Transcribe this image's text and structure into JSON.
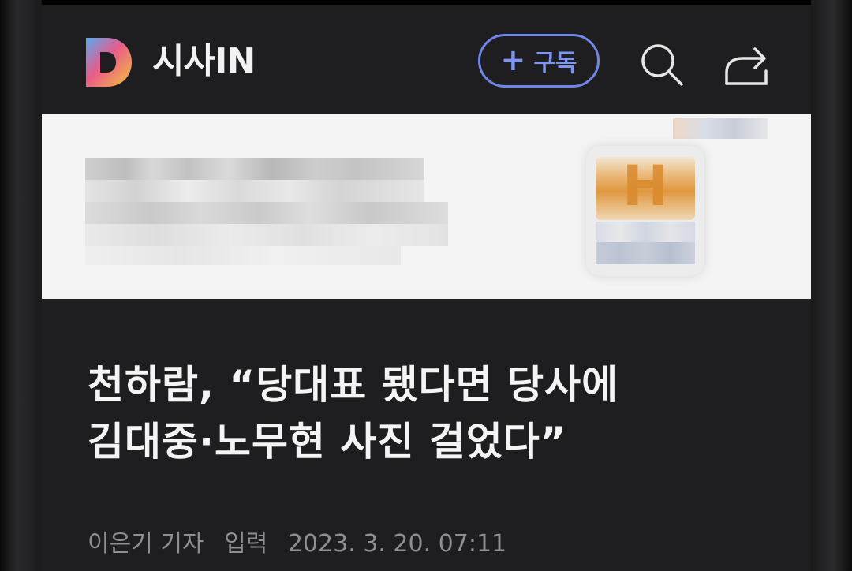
{
  "header": {
    "brand": "시사IN",
    "subscribe_plus": "+",
    "subscribe_label": "구독",
    "logo_icon": "sisain-d-logo",
    "search_icon": "search-icon",
    "share_icon": "share-icon",
    "accent_color": "#6e86e8"
  },
  "banner": {
    "badge_letter": "H"
  },
  "article": {
    "headline_line1": "천하람, “당대표 됐다면 당사에",
    "headline_line2": "김대중·노무현 사진 걸었다”",
    "reporter": "이은기 기자",
    "input_label": "입력",
    "date": "2023. 3. 20. 07:11"
  }
}
